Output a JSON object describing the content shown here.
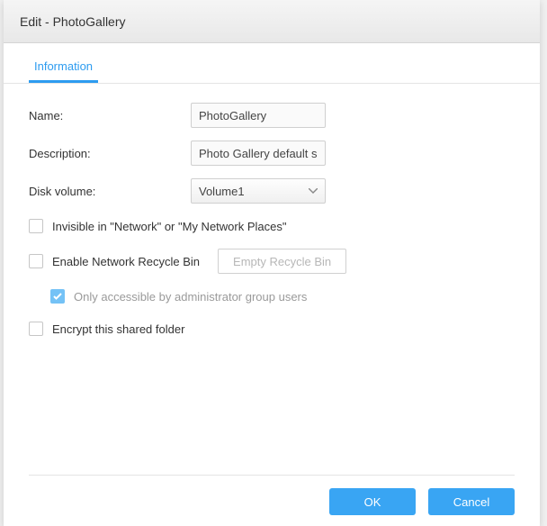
{
  "title": "Edit - PhotoGallery",
  "tabs": {
    "information": "Information"
  },
  "form": {
    "name_label": "Name:",
    "name_value": "PhotoGallery",
    "desc_label": "Description:",
    "desc_value": "Photo Gallery default sh",
    "volume_label": "Disk volume:",
    "volume_value": "Volume1",
    "invisible_label": "Invisible in \"Network\" or \"My Network Places\"",
    "recycle_label": "Enable Network Recycle Bin",
    "empty_recycle_label": "Empty Recycle Bin",
    "admin_only_label": "Only accessible by administrator group users",
    "encrypt_label": "Encrypt this shared folder"
  },
  "footer": {
    "ok": "OK",
    "cancel": "Cancel"
  }
}
